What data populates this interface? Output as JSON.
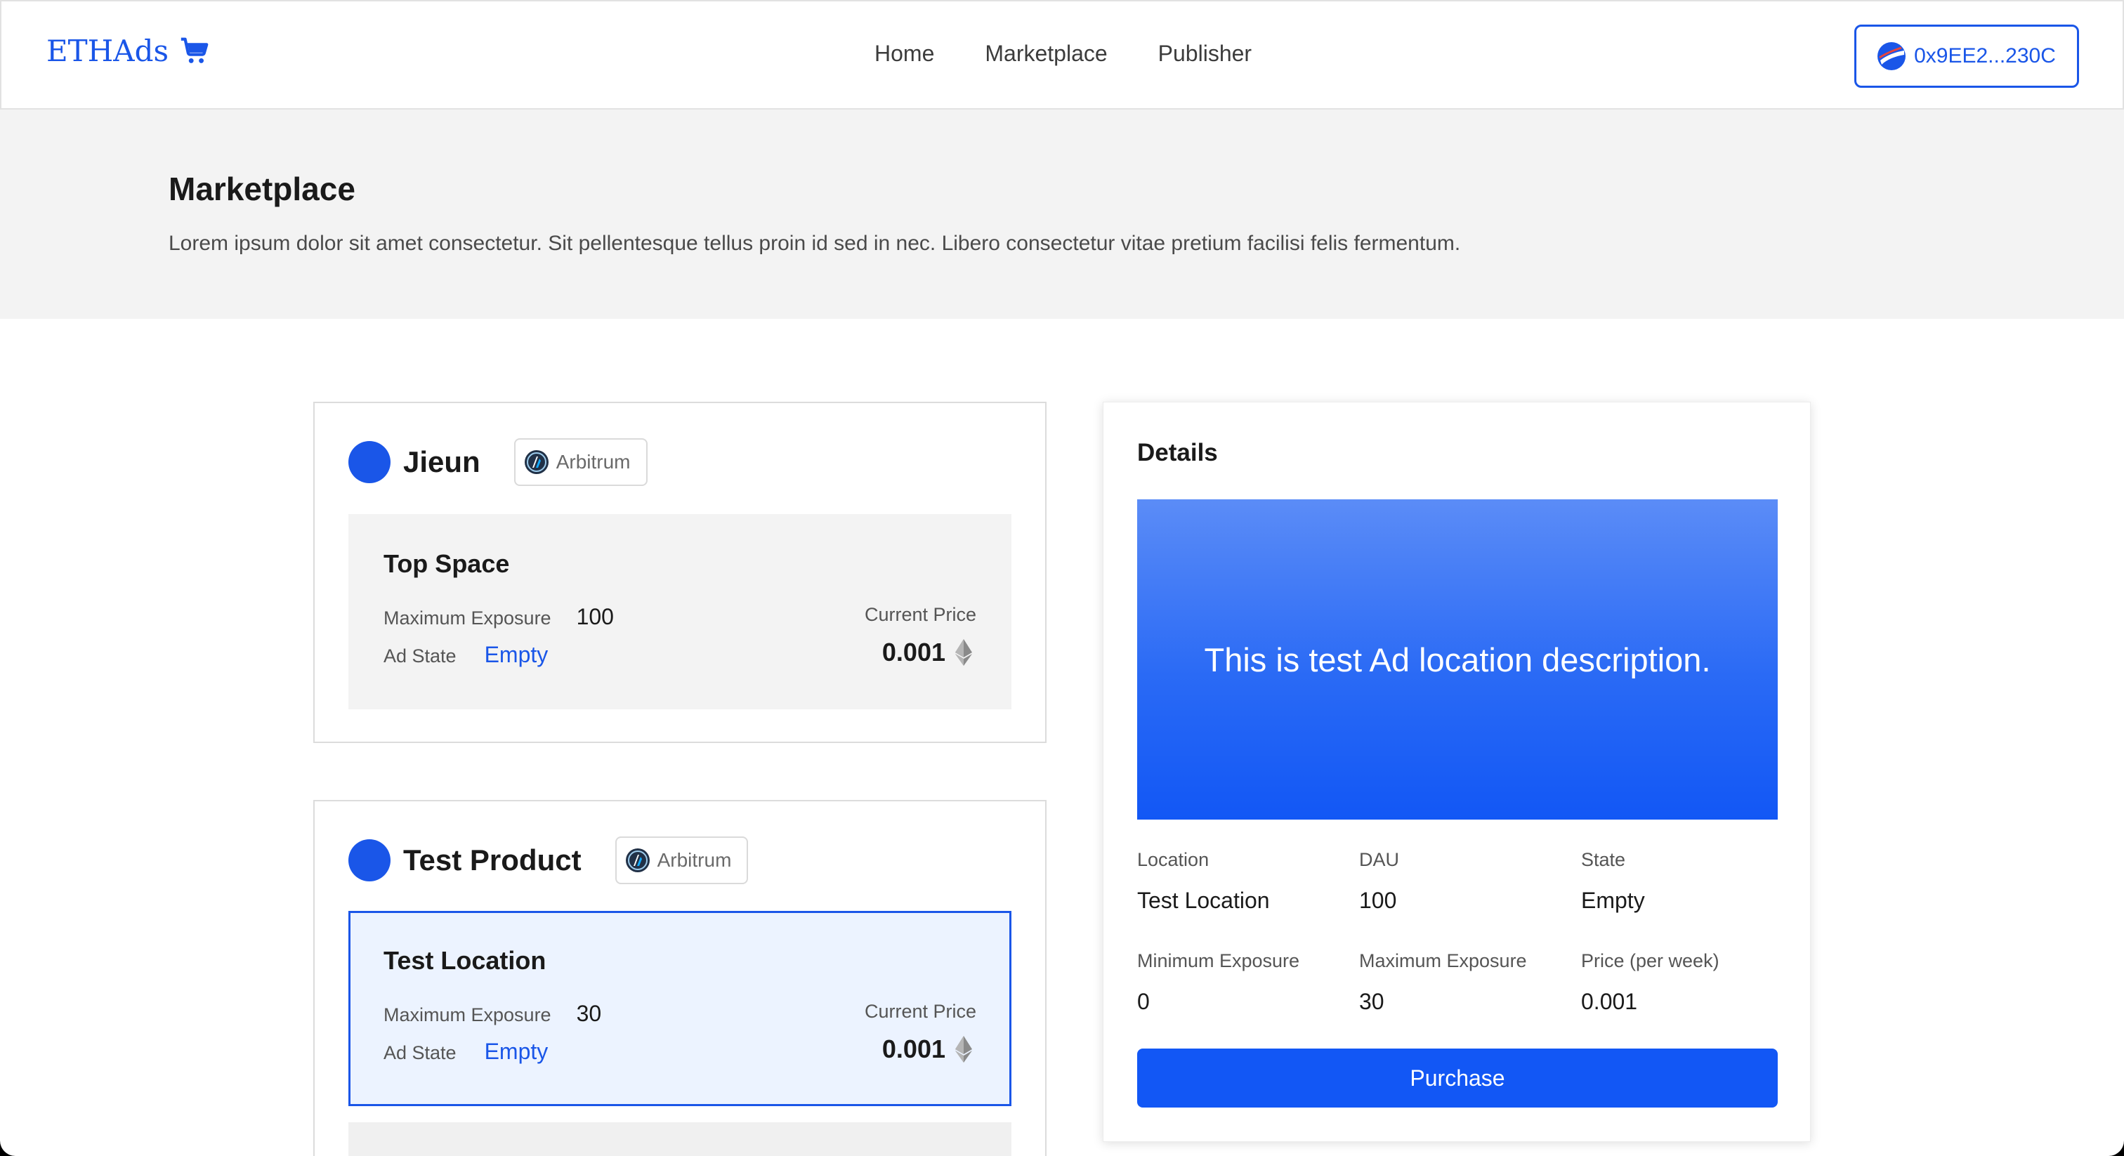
{
  "header": {
    "logo_text": "ETHAds",
    "nav": [
      "Home",
      "Marketplace",
      "Publisher"
    ],
    "wallet_address": "0x9EE2...230C"
  },
  "hero": {
    "title": "Marketplace",
    "description": "Lorem ipsum dolor sit amet consectetur. Sit pellentesque tellus proin id sed in nec. Libero consectetur vitae pretium facilisi felis fermentum."
  },
  "products": [
    {
      "name": "Jieun",
      "chain": "Arbitrum",
      "slots": [
        {
          "title": "Top Space",
          "max_exposure_label": "Maximum Exposure",
          "max_exposure": "100",
          "ad_state_label": "Ad State",
          "ad_state": "Empty",
          "price_label": "Current Price",
          "price": "0.001"
        }
      ]
    },
    {
      "name": "Test Product",
      "chain": "Arbitrum",
      "slots": [
        {
          "title": "Test Location",
          "max_exposure_label": "Maximum Exposure",
          "max_exposure": "30",
          "ad_state_label": "Ad State",
          "ad_state": "Empty",
          "price_label": "Current Price",
          "price": "0.001"
        }
      ]
    }
  ],
  "details": {
    "title": "Details",
    "banner_text": "This is test Ad location description.",
    "fields": [
      {
        "label": "Location",
        "value": "Test Location"
      },
      {
        "label": "DAU",
        "value": "100"
      },
      {
        "label": "State",
        "value": "Empty"
      },
      {
        "label": "Minimum Exposure",
        "value": "0"
      },
      {
        "label": "Maximum Exposure",
        "value": "30"
      },
      {
        "label": "Price (per week)",
        "value": "0.001"
      }
    ],
    "purchase_label": "Purchase"
  },
  "colors": {
    "accent": "#1a56e8",
    "button": "#1257f5",
    "hero_bg": "#f3f3f3",
    "selected_bg": "#ecf3ff"
  },
  "icons": [
    "cart-icon",
    "wallet-avatar-icon",
    "arbitrum-icon",
    "eth-icon"
  ]
}
